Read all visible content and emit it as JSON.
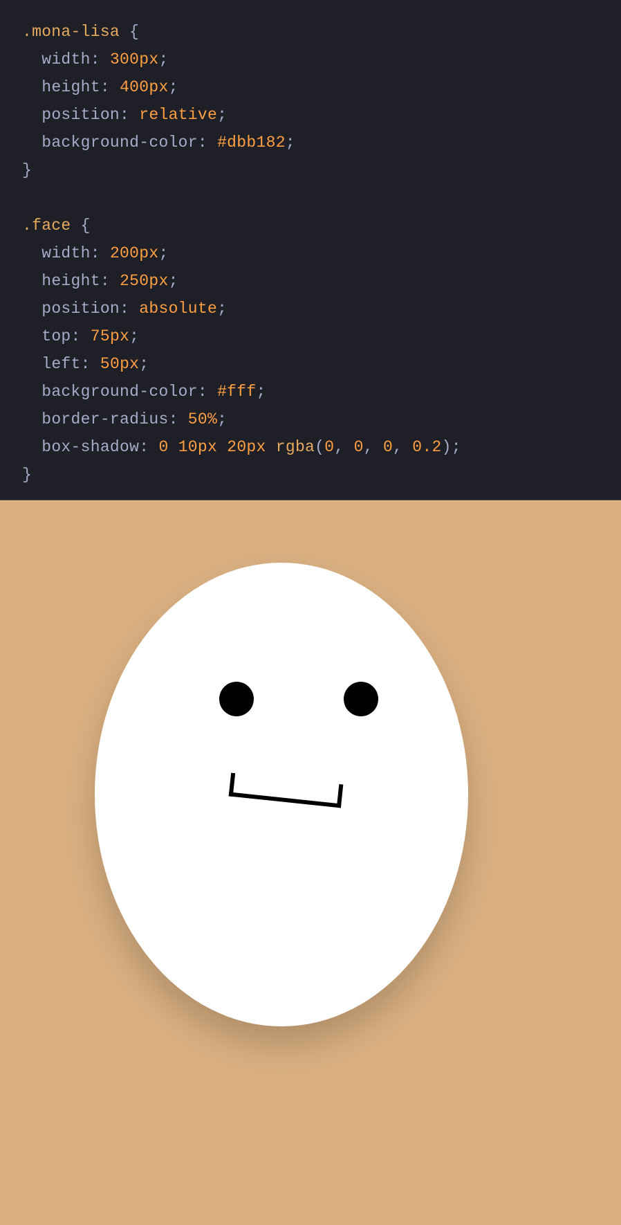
{
  "code": {
    "rule1": {
      "selector": ".mona-lisa",
      "declarations": [
        {
          "prop": "width",
          "val_num": "300px"
        },
        {
          "prop": "height",
          "val_num": "400px"
        },
        {
          "prop": "position",
          "val_kw": "relative"
        },
        {
          "prop": "background-color",
          "val_hex": "#dbb182"
        }
      ]
    },
    "rule2": {
      "selector": ".face",
      "declarations": [
        {
          "prop": "width",
          "val_num": "200px"
        },
        {
          "prop": "height",
          "val_num": "250px"
        },
        {
          "prop": "position",
          "val_kw": "absolute"
        },
        {
          "prop": "top",
          "val_num": "75px"
        },
        {
          "prop": "left",
          "val_num": "50px"
        },
        {
          "prop": "background-color",
          "val_hex": "#fff"
        },
        {
          "prop": "border-radius",
          "val_num": "50%"
        }
      ],
      "box_shadow": {
        "prop": "box-shadow",
        "v1": "0",
        "v2": "10px",
        "v3": "20px",
        "func": "rgba",
        "a1": "0",
        "a2": "0",
        "a3": "0",
        "a4": "0.2"
      }
    }
  },
  "braces": {
    "open": "{",
    "close": "}"
  },
  "punct": {
    "colon": ":",
    "semi": ";",
    "comma": ",",
    "lparen": "(",
    "rparen": ")"
  },
  "space": " ",
  "indent": "  "
}
